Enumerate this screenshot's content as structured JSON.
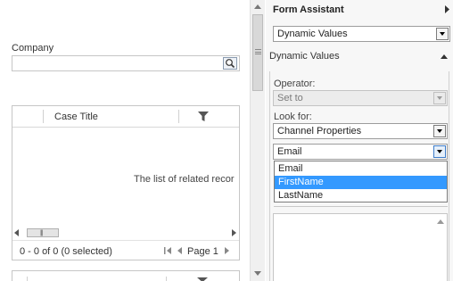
{
  "left": {
    "company_label": "Company",
    "grid": {
      "column_case_title": "Case Title",
      "empty_message": "The list of related recor",
      "record_count": "0 - 0 of 0 (0 selected)",
      "page_label": "Page 1"
    }
  },
  "form_assistant": {
    "title": "Form Assistant",
    "selector_value": "Dynamic Values",
    "section_title": "Dynamic Values",
    "operator_label": "Operator:",
    "operator_value": "Set to",
    "look_for_label": "Look for:",
    "look_for_value": "Channel Properties",
    "field_value": "Email",
    "dropdown_options": [
      "Email",
      "FirstName",
      "LastName"
    ],
    "selected_option_index": 1
  },
  "colors": {
    "selection": "#3399ff",
    "panel_background": "#f7f7f7"
  },
  "icons": [
    "lookup-icon",
    "filter-icon",
    "first-page-icon",
    "prev-page-icon",
    "next-page-icon",
    "chevron-right-icon",
    "collapse-icon",
    "dropdown-arrow-icon"
  ]
}
